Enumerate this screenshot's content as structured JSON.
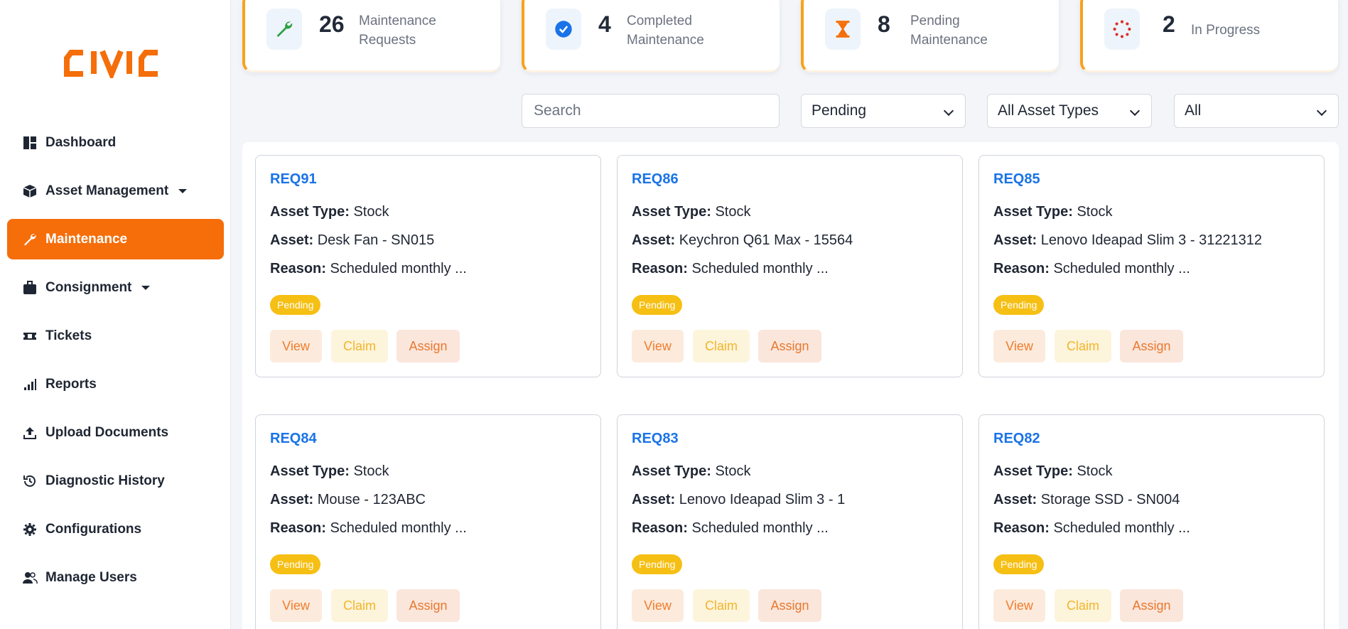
{
  "app": {
    "logo_text": "CIVIC",
    "brand_color": "#f56e0a"
  },
  "sidebar": {
    "items": [
      {
        "label": "Dashboard",
        "icon": "dashboard-icon",
        "active": false,
        "has_caret": false
      },
      {
        "label": "Asset Management",
        "icon": "box-icon",
        "active": false,
        "has_caret": true
      },
      {
        "label": "Maintenance",
        "icon": "wrench-icon",
        "active": true,
        "has_caret": false
      },
      {
        "label": "Consignment",
        "icon": "briefcase-icon",
        "active": false,
        "has_caret": true
      },
      {
        "label": "Tickets",
        "icon": "ticket-icon",
        "active": false,
        "has_caret": false
      },
      {
        "label": "Reports",
        "icon": "bar-chart-icon",
        "active": false,
        "has_caret": false
      },
      {
        "label": "Upload Documents",
        "icon": "upload-icon",
        "active": false,
        "has_caret": false
      },
      {
        "label": "Diagnostic History",
        "icon": "history-icon",
        "active": false,
        "has_caret": false
      },
      {
        "label": "Configurations",
        "icon": "gear-icon",
        "active": false,
        "has_caret": false
      },
      {
        "label": "Manage Users",
        "icon": "users-icon",
        "active": false,
        "has_caret": false
      }
    ]
  },
  "stats": [
    {
      "value": "26",
      "label1": "Maintenance",
      "label2": "Requests",
      "icon": "wrench-icon"
    },
    {
      "value": "4",
      "label1": "Completed",
      "label2": "Maintenance",
      "icon": "check-circle-icon"
    },
    {
      "value": "8",
      "label1": "Pending",
      "label2": "Maintenance",
      "icon": "hourglass-icon"
    },
    {
      "value": "2",
      "label1": "In Progress",
      "label2": "",
      "icon": "spinner-icon"
    }
  ],
  "filters": {
    "search_placeholder": "Search",
    "status": "Pending",
    "asset_type": "All Asset Types",
    "scope": "All"
  },
  "labels": {
    "asset_type": "Asset Type:",
    "asset": "Asset:",
    "reason": "Reason:",
    "view": "View",
    "claim": "Claim",
    "assign": "Assign"
  },
  "requests": [
    {
      "id": "REQ91",
      "asset_type": "Stock",
      "asset": "Desk Fan - SN015",
      "reason": "Scheduled monthly ...",
      "status": "Pending"
    },
    {
      "id": "REQ86",
      "asset_type": "Stock",
      "asset": "Keychron Q61 Max - 15564",
      "reason": "Scheduled monthly ...",
      "status": "Pending"
    },
    {
      "id": "REQ85",
      "asset_type": "Stock",
      "asset": "Lenovo Ideapad Slim 3 - 31221312",
      "reason": "Scheduled monthly ...",
      "status": "Pending"
    },
    {
      "id": "REQ84",
      "asset_type": "Stock",
      "asset": "Mouse - 123ABC",
      "reason": "Scheduled monthly ...",
      "status": "Pending"
    },
    {
      "id": "REQ83",
      "asset_type": "Stock",
      "asset": "Lenovo Ideapad Slim 3 - 1",
      "reason": "Scheduled monthly ...",
      "status": "Pending"
    },
    {
      "id": "REQ82",
      "asset_type": "Stock",
      "asset": "Storage SSD - SN004",
      "reason": "Scheduled monthly ...",
      "status": "Pending"
    }
  ]
}
